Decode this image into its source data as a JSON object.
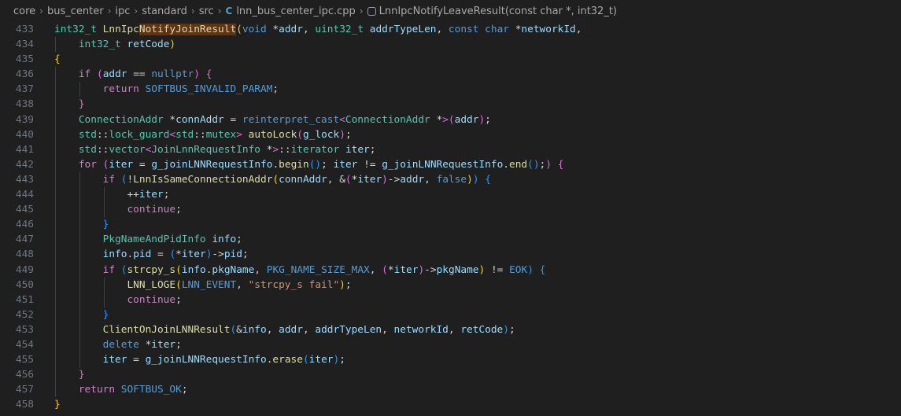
{
  "breadcrumb": {
    "items": [
      "core",
      "bus_center",
      "ipc",
      "standard",
      "src"
    ],
    "file": "lnn_bus_center_ipc.cpp",
    "file_icon": "C++",
    "symbol": "LnnIpcNotifyLeaveResult(const char *, int32_t)"
  },
  "code_lines": [
    {
      "n": "433",
      "indent": 0,
      "t": [
        [
          "type",
          "int32_t"
        ],
        [
          "p",
          " "
        ],
        [
          "fn",
          "LnnIpc"
        ],
        [
          "hl",
          "NotifyJoinResult"
        ],
        [
          "b1",
          "("
        ],
        [
          "kw",
          "void"
        ],
        [
          "p",
          " *"
        ],
        [
          "var",
          "addr"
        ],
        [
          "p",
          ", "
        ],
        [
          "type",
          "uint32_t"
        ],
        [
          "p",
          " "
        ],
        [
          "var",
          "addrTypeLen"
        ],
        [
          "p",
          ", "
        ],
        [
          "kw",
          "const"
        ],
        [
          "p",
          " "
        ],
        [
          "kw",
          "char"
        ],
        [
          "p",
          " *"
        ],
        [
          "var",
          "networkId"
        ],
        [
          "p",
          ","
        ]
      ]
    },
    {
      "n": "434",
      "indent": 4,
      "t": [
        [
          "type",
          "int32_t"
        ],
        [
          "p",
          " "
        ],
        [
          "var",
          "retCode"
        ],
        [
          "b1",
          ")"
        ]
      ]
    },
    {
      "n": "435",
      "indent": 0,
      "t": [
        [
          "b1",
          "{"
        ]
      ]
    },
    {
      "n": "436",
      "indent": 4,
      "t": [
        [
          "ctl",
          "if"
        ],
        [
          "p",
          " "
        ],
        [
          "b2",
          "("
        ],
        [
          "var",
          "addr"
        ],
        [
          "p",
          " == "
        ],
        [
          "kw",
          "nullptr"
        ],
        [
          "b2",
          ")"
        ],
        [
          "p",
          " "
        ],
        [
          "b2",
          "{"
        ]
      ]
    },
    {
      "n": "437",
      "indent": 8,
      "t": [
        [
          "ctl",
          "return"
        ],
        [
          "p",
          " "
        ],
        [
          "mac",
          "SOFTBUS_INVALID_PARAM"
        ],
        [
          "p",
          ";"
        ]
      ]
    },
    {
      "n": "438",
      "indent": 4,
      "t": [
        [
          "b2",
          "}"
        ]
      ]
    },
    {
      "n": "439",
      "indent": 4,
      "t": [
        [
          "type",
          "ConnectionAddr"
        ],
        [
          "p",
          " *"
        ],
        [
          "var",
          "connAddr"
        ],
        [
          "p",
          " = "
        ],
        [
          "kw",
          "reinterpret_cast"
        ],
        [
          "b2",
          "<"
        ],
        [
          "type",
          "ConnectionAddr"
        ],
        [
          "p",
          " *"
        ],
        [
          "b2",
          ">"
        ],
        [
          "b2",
          "("
        ],
        [
          "var",
          "addr"
        ],
        [
          "b2",
          ")"
        ],
        [
          "p",
          ";"
        ]
      ]
    },
    {
      "n": "440",
      "indent": 4,
      "t": [
        [
          "type",
          "std"
        ],
        [
          "p",
          "::"
        ],
        [
          "type",
          "lock_guard"
        ],
        [
          "b2",
          "<"
        ],
        [
          "type",
          "std"
        ],
        [
          "p",
          "::"
        ],
        [
          "type",
          "mutex"
        ],
        [
          "b2",
          ">"
        ],
        [
          "p",
          " "
        ],
        [
          "fn",
          "autoLock"
        ],
        [
          "b2",
          "("
        ],
        [
          "var",
          "g_lock"
        ],
        [
          "b2",
          ")"
        ],
        [
          "p",
          ";"
        ]
      ]
    },
    {
      "n": "441",
      "indent": 4,
      "t": [
        [
          "type",
          "std"
        ],
        [
          "p",
          "::"
        ],
        [
          "type",
          "vector"
        ],
        [
          "b2",
          "<"
        ],
        [
          "type",
          "JoinLnnRequestInfo"
        ],
        [
          "p",
          " *"
        ],
        [
          "b2",
          ">"
        ],
        [
          "p",
          "::"
        ],
        [
          "type",
          "iterator"
        ],
        [
          "p",
          " "
        ],
        [
          "var",
          "iter"
        ],
        [
          "p",
          ";"
        ]
      ]
    },
    {
      "n": "442",
      "indent": 4,
      "t": [
        [
          "ctl",
          "for"
        ],
        [
          "p",
          " "
        ],
        [
          "b2",
          "("
        ],
        [
          "var",
          "iter"
        ],
        [
          "p",
          " = "
        ],
        [
          "var",
          "g_joinLNNRequestInfo"
        ],
        [
          "p",
          "."
        ],
        [
          "fn",
          "begin"
        ],
        [
          "b3",
          "()"
        ],
        [
          "p",
          "; "
        ],
        [
          "var",
          "iter"
        ],
        [
          "p",
          " != "
        ],
        [
          "var",
          "g_joinLNNRequestInfo"
        ],
        [
          "p",
          "."
        ],
        [
          "fn",
          "end"
        ],
        [
          "b3",
          "()"
        ],
        [
          "p",
          ";"
        ],
        [
          "b2",
          ")"
        ],
        [
          "p",
          " "
        ],
        [
          "b2",
          "{"
        ]
      ]
    },
    {
      "n": "443",
      "indent": 8,
      "t": [
        [
          "ctl",
          "if"
        ],
        [
          "p",
          " "
        ],
        [
          "b3",
          "("
        ],
        [
          "p",
          "!"
        ],
        [
          "fn",
          "LnnIsSameConnectionAddr"
        ],
        [
          "b1",
          "("
        ],
        [
          "var",
          "connAddr"
        ],
        [
          "p",
          ", &"
        ],
        [
          "b2",
          "("
        ],
        [
          "p",
          "*"
        ],
        [
          "var",
          "iter"
        ],
        [
          "b2",
          ")"
        ],
        [
          "p",
          "->"
        ],
        [
          "var",
          "addr"
        ],
        [
          "p",
          ", "
        ],
        [
          "kw",
          "false"
        ],
        [
          "b1",
          ")"
        ],
        [
          "b3",
          ")"
        ],
        [
          "p",
          " "
        ],
        [
          "b3",
          "{"
        ]
      ]
    },
    {
      "n": "444",
      "indent": 12,
      "t": [
        [
          "p",
          "++"
        ],
        [
          "var",
          "iter"
        ],
        [
          "p",
          ";"
        ]
      ]
    },
    {
      "n": "445",
      "indent": 12,
      "t": [
        [
          "ctl",
          "continue"
        ],
        [
          "p",
          ";"
        ]
      ]
    },
    {
      "n": "446",
      "indent": 8,
      "t": [
        [
          "b3",
          "}"
        ]
      ]
    },
    {
      "n": "447",
      "indent": 8,
      "t": [
        [
          "type",
          "PkgNameAndPidInfo"
        ],
        [
          "p",
          " "
        ],
        [
          "var",
          "info"
        ],
        [
          "p",
          ";"
        ]
      ]
    },
    {
      "n": "448",
      "indent": 8,
      "t": [
        [
          "var",
          "info"
        ],
        [
          "p",
          "."
        ],
        [
          "var",
          "pid"
        ],
        [
          "p",
          " = "
        ],
        [
          "b3",
          "("
        ],
        [
          "p",
          "*"
        ],
        [
          "var",
          "iter"
        ],
        [
          "b3",
          ")"
        ],
        [
          "p",
          "->"
        ],
        [
          "var",
          "pid"
        ],
        [
          "p",
          ";"
        ]
      ]
    },
    {
      "n": "449",
      "indent": 8,
      "t": [
        [
          "ctl",
          "if"
        ],
        [
          "p",
          " "
        ],
        [
          "b3",
          "("
        ],
        [
          "fn",
          "strcpy_s"
        ],
        [
          "b1",
          "("
        ],
        [
          "var",
          "info"
        ],
        [
          "p",
          "."
        ],
        [
          "var",
          "pkgName"
        ],
        [
          "p",
          ", "
        ],
        [
          "mac",
          "PKG_NAME_SIZE_MAX"
        ],
        [
          "p",
          ", "
        ],
        [
          "b2",
          "("
        ],
        [
          "p",
          "*"
        ],
        [
          "var",
          "iter"
        ],
        [
          "b2",
          ")"
        ],
        [
          "p",
          "->"
        ],
        [
          "var",
          "pkgName"
        ],
        [
          "b1",
          ")"
        ],
        [
          "p",
          " != "
        ],
        [
          "mac",
          "EOK"
        ],
        [
          "b3",
          ")"
        ],
        [
          "p",
          " "
        ],
        [
          "b3",
          "{"
        ]
      ]
    },
    {
      "n": "450",
      "indent": 12,
      "t": [
        [
          "fn",
          "LNN_LOGE"
        ],
        [
          "b1",
          "("
        ],
        [
          "mac",
          "LNN_EVENT"
        ],
        [
          "p",
          ", "
        ],
        [
          "str",
          "\"strcpy_s fail\""
        ],
        [
          "b1",
          ")"
        ],
        [
          "p",
          ";"
        ]
      ]
    },
    {
      "n": "451",
      "indent": 12,
      "t": [
        [
          "ctl",
          "continue"
        ],
        [
          "p",
          ";"
        ]
      ]
    },
    {
      "n": "452",
      "indent": 8,
      "t": [
        [
          "b3",
          "}"
        ]
      ]
    },
    {
      "n": "453",
      "indent": 8,
      "t": [
        [
          "fn",
          "ClientOnJoinLNNResult"
        ],
        [
          "b3",
          "("
        ],
        [
          "p",
          "&"
        ],
        [
          "var",
          "info"
        ],
        [
          "p",
          ", "
        ],
        [
          "var",
          "addr"
        ],
        [
          "p",
          ", "
        ],
        [
          "var",
          "addrTypeLen"
        ],
        [
          "p",
          ", "
        ],
        [
          "var",
          "networkId"
        ],
        [
          "p",
          ", "
        ],
        [
          "var",
          "retCode"
        ],
        [
          "b3",
          ")"
        ],
        [
          "p",
          ";"
        ]
      ]
    },
    {
      "n": "454",
      "indent": 8,
      "t": [
        [
          "kw",
          "delete"
        ],
        [
          "p",
          " *"
        ],
        [
          "var",
          "iter"
        ],
        [
          "p",
          ";"
        ]
      ]
    },
    {
      "n": "455",
      "indent": 8,
      "t": [
        [
          "var",
          "iter"
        ],
        [
          "p",
          " = "
        ],
        [
          "var",
          "g_joinLNNRequestInfo"
        ],
        [
          "p",
          "."
        ],
        [
          "fn",
          "erase"
        ],
        [
          "b3",
          "("
        ],
        [
          "var",
          "iter"
        ],
        [
          "b3",
          ")"
        ],
        [
          "p",
          ";"
        ]
      ]
    },
    {
      "n": "456",
      "indent": 4,
      "t": [
        [
          "b2",
          "}"
        ]
      ]
    },
    {
      "n": "457",
      "indent": 4,
      "t": [
        [
          "ctl",
          "return"
        ],
        [
          "p",
          " "
        ],
        [
          "mac",
          "SOFTBUS_OK"
        ],
        [
          "p",
          ";"
        ]
      ]
    },
    {
      "n": "458",
      "indent": 0,
      "t": [
        [
          "b1",
          "}"
        ]
      ]
    }
  ]
}
